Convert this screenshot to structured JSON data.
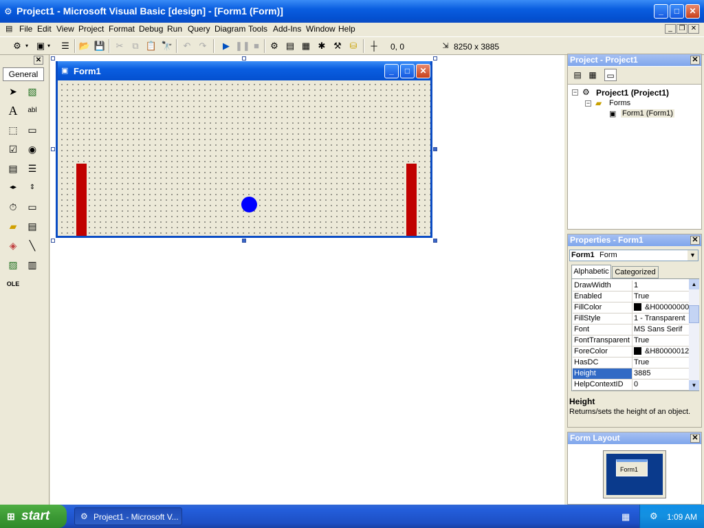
{
  "window": {
    "title": "Project1 - Microsoft Visual Basic [design] - [Form1 (Form)]",
    "min": "_",
    "max": "□",
    "close": "✕",
    "mdi_min": "_",
    "mdi_max": "❐",
    "mdi_close": "✕"
  },
  "menu": [
    "File",
    "Edit",
    "View",
    "Project",
    "Format",
    "Debug",
    "Run",
    "Query",
    "Diagram",
    "Tools",
    "Add-Ins",
    "Window",
    "Help"
  ],
  "toolbar": {
    "position": "0, 0",
    "size": "8250 x 3885"
  },
  "toolbox": {
    "tab_label": "General",
    "close": "✕"
  },
  "form": {
    "title": "Form1",
    "min": "_",
    "max": "□",
    "close": "✕",
    "paddle_color": "#c00000",
    "ball_color": "#0000ff"
  },
  "project_explorer": {
    "title": "Project - Project1",
    "close": "✕",
    "root": "Project1 (Project1)",
    "folder": "Forms",
    "item": "Form1 (Form1)"
  },
  "properties": {
    "title": "Properties - Form1",
    "close": "✕",
    "object_name": "Form1",
    "object_type": "Form",
    "tab_alphabetic": "Alphabetic",
    "tab_categorized": "Categorized",
    "rows": [
      {
        "name": "DrawWidth",
        "value": "1"
      },
      {
        "name": "Enabled",
        "value": "True"
      },
      {
        "name": "FillColor",
        "value": "&H00000000"
      },
      {
        "name": "FillStyle",
        "value": "1 - Transparent"
      },
      {
        "name": "Font",
        "value": "MS Sans Serif"
      },
      {
        "name": "FontTransparent",
        "value": "True"
      },
      {
        "name": "ForeColor",
        "value": "&H80000012"
      },
      {
        "name": "HasDC",
        "value": "True"
      },
      {
        "name": "Height",
        "value": "3885"
      },
      {
        "name": "HelpContextID",
        "value": "0"
      }
    ],
    "selected_row": "Height",
    "desc_title": "Height",
    "desc_text": "Returns/sets the height of an object."
  },
  "form_layout": {
    "title": "Form Layout",
    "close": "✕",
    "preview_label": "Form1"
  },
  "taskbar": {
    "start": "start",
    "task": "Project1 - Microsoft V...",
    "clock": "1:09 AM"
  },
  "colors": {
    "xp_blue": "#0a5ee0",
    "face": "#ece9d8",
    "selection": "#316ac5"
  }
}
